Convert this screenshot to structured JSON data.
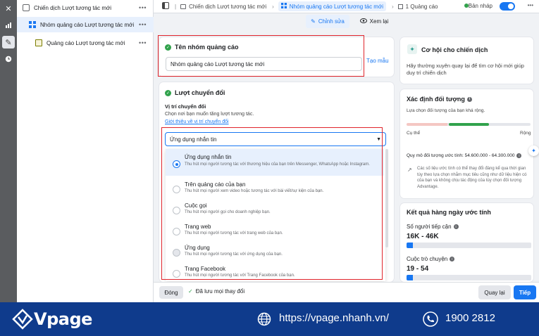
{
  "tree": {
    "campaign": "Chiến dịch Lượt tương tác mới",
    "adset": "Nhóm quảng cáo Lượt tương tác mới",
    "ad": "Quảng cáo Lượt tương tác mới",
    "more": "•••"
  },
  "topbar": {
    "crumb_campaign": "Chiến dịch Lượt tương tác mới",
    "crumb_adset": "Nhóm quảng cáo Lượt tương tác mới",
    "crumb_ad": "1 Quảng cáo",
    "status": "Bản nháp"
  },
  "tabs": {
    "edit": "Chỉnh sửa",
    "view": "Xem lại"
  },
  "adset_name": {
    "title": "Tên nhóm quảng cáo",
    "value": "Nhóm quảng cáo Lượt tương tác mới",
    "template_link": "Tạo mẫu"
  },
  "conversion": {
    "title": "Lượt chuyển đổi",
    "location_label": "Vị trí chuyển đổi",
    "location_desc": "Chọn nơi bạn muốn tăng lượt tương tác.",
    "learn_link": "Giới thiệu về vị trí chuyển đổi",
    "selected": "Ứng dụng nhắn tin",
    "options": [
      {
        "title": "Ứng dụng nhắn tin",
        "desc": "Thu hút mọi người tương tác với thương hiệu của bạn trên Messenger, WhatsApp hoặc Instagram."
      },
      {
        "title": "Trên quảng cáo của bạn",
        "desc": "Thu hút mọi người xem video hoặc tương tác với bài viết/sự kiện của bạn."
      },
      {
        "title": "Cuộc gọi",
        "desc": "Thu hút mọi người gọi cho doanh nghiệp bạn."
      },
      {
        "title": "Trang web",
        "desc": "Thu hút mọi người tương tác với trang web của bạn."
      },
      {
        "title": "Ứng dụng",
        "desc": "Thu hút mọi người tương tác với ứng dụng của bạn."
      },
      {
        "title": "Trang Facebook",
        "desc": "Thu hút mọi người tương tác với Trang Facebook của bạn."
      }
    ]
  },
  "opportunity": {
    "title": "Cơ hội cho chiến dịch",
    "desc": "Hãy thường xuyên quay lại để tìm cơ hội mới giúp duy trì chiến dịch"
  },
  "audience": {
    "title": "Xác định đối tượng",
    "desc": "Lựa chọn đối tượng của bạn khá rộng.",
    "specific": "Cụ thể",
    "broad": "Rộng",
    "size": "Quy mô đối tượng ước tính: 54.600.000 - 64.300.000",
    "note": "Các số liệu ước tính có thể thay đổi đáng kể qua thời gian tùy theo lựa chọn nhắm mục tiêu cũng như dữ liệu hiện có của bạn và không chịu tác động của tùy chọn đối tượng Advantage."
  },
  "daily": {
    "title": "Kết quả hàng ngày ước tính",
    "reach_label": "Số người tiếp cận",
    "reach_value": "16K - 46K",
    "conv_label": "Cuộc trò chuyện",
    "conv_value": "19 - 54"
  },
  "footer": {
    "close": "Đóng",
    "saved": "Đã lưu mọi thay đổi",
    "back": "Quay lại",
    "next": "Tiếp"
  },
  "banner": {
    "logo": "Vpage",
    "website": "https://vpage.nhanh.vn/",
    "phone": "1900 2812"
  }
}
